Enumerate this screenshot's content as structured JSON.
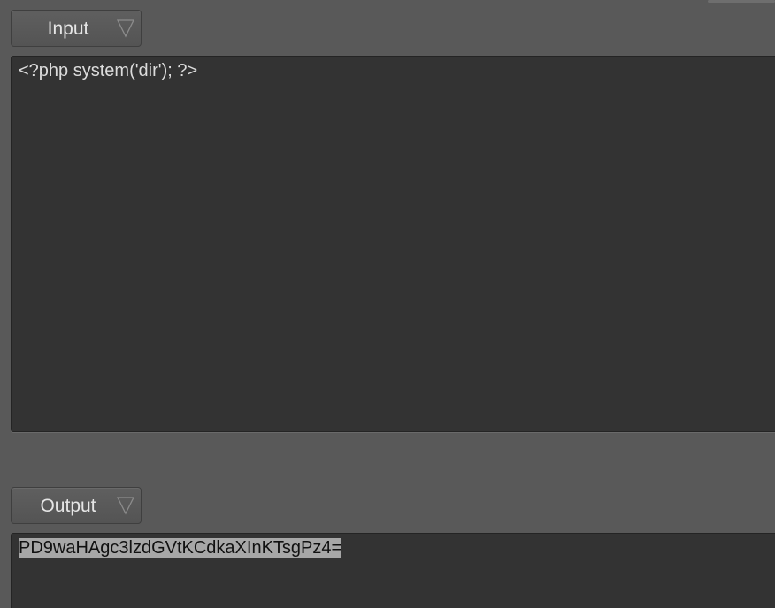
{
  "input": {
    "dropdown_label": "Input",
    "text": "<?php system('dir'); ?>"
  },
  "output": {
    "dropdown_label": "Output",
    "text": "PD9waHAgc3lzdGVtKCdkaXInKTsgPz4="
  },
  "icons": {
    "dropdown_arrow": "chevron-down-icon"
  },
  "colors": {
    "background": "#595959",
    "textbox": "#333333",
    "text": "#dcdcdc",
    "selection": "#a7a7a7"
  }
}
